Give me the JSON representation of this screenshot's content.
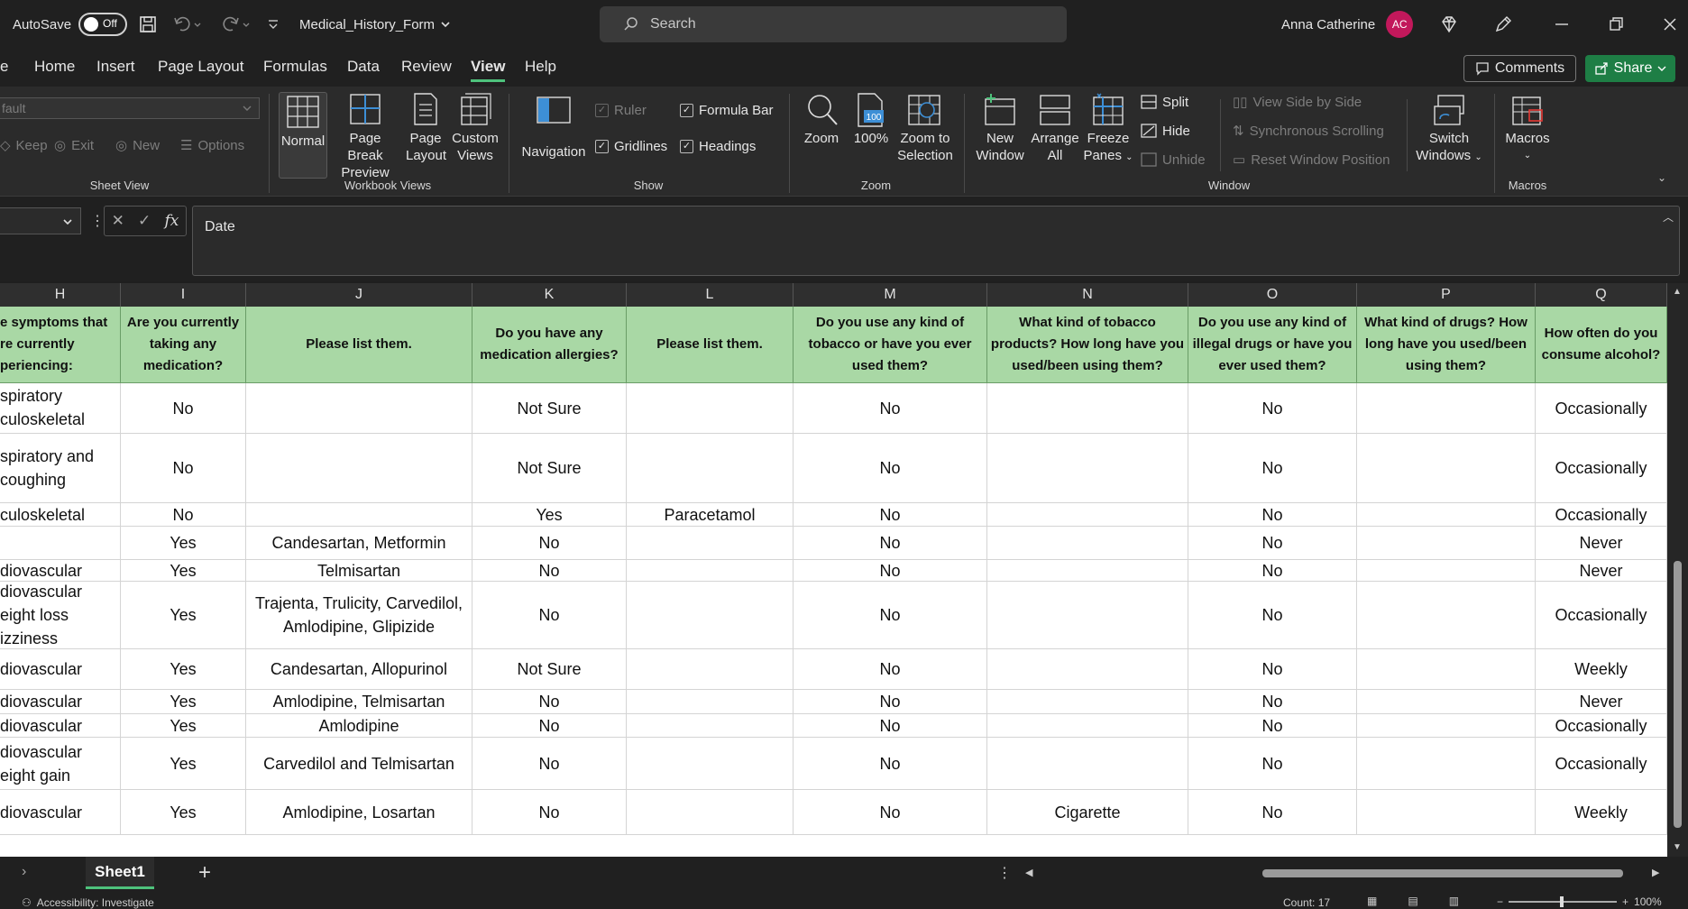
{
  "titlebar": {
    "autosave_label": "AutoSave",
    "autosave_state": "Off",
    "filename": "Medical_History_Form",
    "search_placeholder": "Search",
    "user_name": "Anna Catherine",
    "user_initials": "AC"
  },
  "menu": {
    "items": [
      "e",
      "Home",
      "Insert",
      "Page Layout",
      "Formulas",
      "Data",
      "Review",
      "View",
      "Help"
    ],
    "active": "View",
    "comments": "Comments",
    "share": "Share"
  },
  "ribbon": {
    "sheet_view": {
      "dropdown_value": "fault",
      "keep": "Keep",
      "exit": "Exit",
      "new": "New",
      "options": "Options",
      "label": "Sheet View"
    },
    "workbook_views": {
      "normal": "Normal",
      "page_break_1": "Page Break",
      "page_break_2": "Preview",
      "page_layout_1": "Page",
      "page_layout_2": "Layout",
      "custom_1": "Custom",
      "custom_2": "Views",
      "label": "Workbook Views"
    },
    "show": {
      "navigation": "Navigation",
      "ruler": "Ruler",
      "gridlines": "Gridlines",
      "formula_bar": "Formula Bar",
      "headings": "Headings",
      "label": "Show"
    },
    "zoom": {
      "zoom": "Zoom",
      "hundred": "100%",
      "zts_1": "Zoom to",
      "zts_2": "Selection",
      "label": "Zoom"
    },
    "window": {
      "new_1": "New",
      "new_2": "Window",
      "arrange_1": "Arrange",
      "arrange_2": "All",
      "freeze_1": "Freeze",
      "freeze_2": "Panes",
      "split": "Split",
      "hide": "Hide",
      "unhide": "Unhide",
      "side_by_side": "View Side by Side",
      "sync_scroll": "Synchronous Scrolling",
      "reset_pos": "Reset Window Position",
      "switch_1": "Switch",
      "switch_2": "Windows",
      "label": "Window"
    },
    "macros": {
      "macros": "Macros",
      "label": "Macros"
    }
  },
  "formula": {
    "content": "Date"
  },
  "columns": [
    "H",
    "I",
    "J",
    "K",
    "L",
    "M",
    "N",
    "O",
    "P",
    "Q"
  ],
  "headers": [
    "e symptoms that re currently periencing:",
    "Are you currently taking any medication?",
    "Please list them.",
    "Do you have any medication allergies?",
    "Please list them.",
    "Do you use any kind of tobacco or have you ever used them?",
    "What kind of tobacco products? How long have you used/been using them?",
    "Do you use any kind of illegal drugs or have you ever used them?",
    "What kind of drugs? How long have you used/been using them?",
    "How often do you consume alcohol?"
  ],
  "rows": [
    {
      "h": "nest pain spiratory culoskeletal",
      "i": "No",
      "j": "",
      "k": "Not Sure",
      "l": "",
      "m": "No",
      "n": "",
      "o": "No",
      "p": "",
      "q": "Occasionally"
    },
    {
      "h": "spiratory and coughing",
      "i": "No",
      "j": "",
      "k": "Not Sure",
      "l": "",
      "m": "No",
      "n": "",
      "o": "No",
      "p": "",
      "q": "Occasionally"
    },
    {
      "h": "culoskeletal",
      "i": "No",
      "j": "",
      "k": "Yes",
      "l": "Paracetamol",
      "m": "No",
      "n": "",
      "o": "No",
      "p": "",
      "q": "Occasionally"
    },
    {
      "h": "",
      "i": "Yes",
      "j": "Candesartan, Metformin",
      "k": "No",
      "l": "",
      "m": "No",
      "n": "",
      "o": "No",
      "p": "",
      "q": "Never"
    },
    {
      "h": "diovascular",
      "i": "Yes",
      "j": "Telmisartan",
      "k": "No",
      "l": "",
      "m": "No",
      "n": "",
      "o": "No",
      "p": "",
      "q": "Never"
    },
    {
      "h": "diovascular eight loss izziness",
      "i": "Yes",
      "j": "Trajenta, Trulicity, Carvedilol, Amlodipine, Glipizide",
      "k": "No",
      "l": "",
      "m": "No",
      "n": "",
      "o": "No",
      "p": "",
      "q": "Occasionally"
    },
    {
      "h": "diovascular",
      "i": "Yes",
      "j": "Candesartan, Allopurinol",
      "k": "Not Sure",
      "l": "",
      "m": "No",
      "n": "",
      "o": "No",
      "p": "",
      "q": "Weekly"
    },
    {
      "h": "diovascular",
      "i": "Yes",
      "j": "Amlodipine, Telmisartan",
      "k": "No",
      "l": "",
      "m": "No",
      "n": "",
      "o": "No",
      "p": "",
      "q": "Never"
    },
    {
      "h": "diovascular",
      "i": "Yes",
      "j": "Amlodipine",
      "k": "No",
      "l": "",
      "m": "No",
      "n": "",
      "o": "No",
      "p": "",
      "q": "Occasionally"
    },
    {
      "h": "diovascular eight gain",
      "i": "Yes",
      "j": "Carvedilol and Telmisartan",
      "k": "No",
      "l": "",
      "m": "No",
      "n": "",
      "o": "No",
      "p": "",
      "q": "Occasionally"
    },
    {
      "h": "diovascular",
      "i": "Yes",
      "j": "Amlodipine, Losartan",
      "k": "No",
      "l": "",
      "m": "No",
      "n": "Cigarette",
      "o": "No",
      "p": "",
      "q": "Weekly"
    }
  ],
  "sheet": {
    "tab": "Sheet1",
    "add": "+"
  },
  "status": {
    "accessibility": "Accessibility: Investigate",
    "count": "Count: 17",
    "zoom": "100%"
  }
}
